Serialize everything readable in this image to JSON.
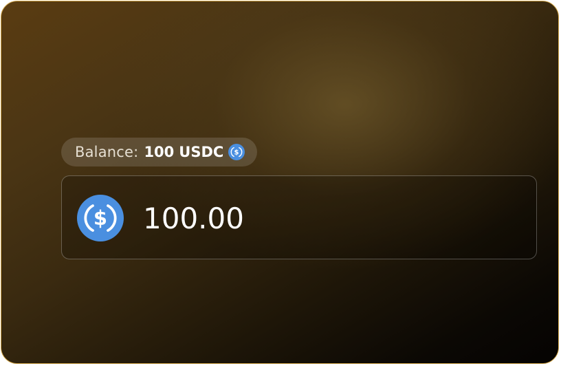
{
  "colors": {
    "card_border": "#d4a84a",
    "coin_blue": "#2775ca",
    "text_primary": "#ffffff"
  },
  "balance": {
    "label": "Balance:",
    "amount": "100",
    "unit": "USDC",
    "icon": "usdc-coin-icon"
  },
  "amount_input": {
    "value": "100.00",
    "token_icon": "usdc-coin-icon"
  }
}
